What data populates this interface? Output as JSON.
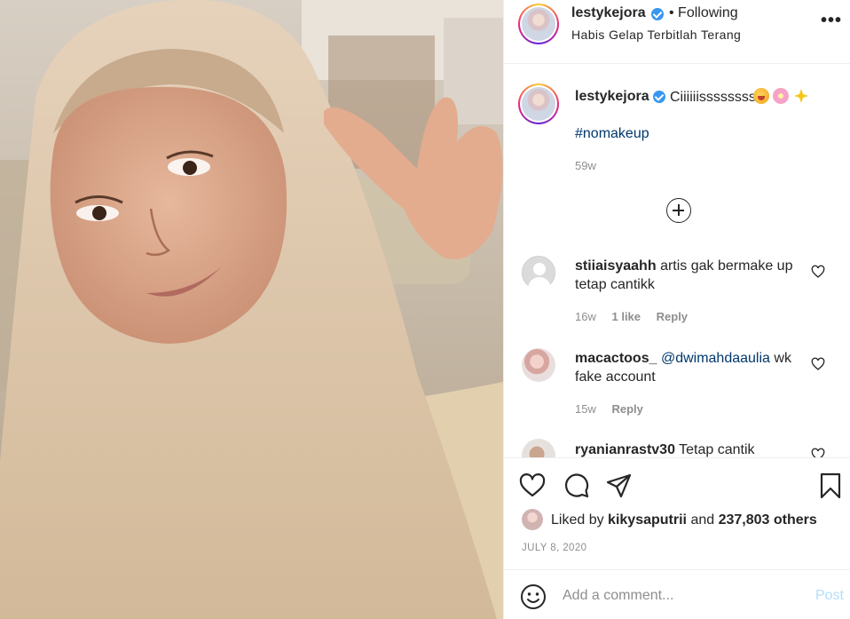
{
  "post": {
    "author": "lestykejora",
    "follow_state": "• Following",
    "location": "Habis Gelap Terbitlah Terang",
    "more_label": "•••",
    "caption_text": "Ciiiiiissssssss",
    "hashtag": "#nomakeup",
    "caption_time": "59w"
  },
  "comments": [
    {
      "username": "stiiaisyaahh",
      "text": "artis gak bermake up tetap cantikk",
      "time": "16w",
      "likes": "1 like",
      "reply": "Reply"
    },
    {
      "username": "macactoos_",
      "mention": "@dwimahdaaulia",
      "text": "wk fake account",
      "time": "15w",
      "reply": "Reply"
    },
    {
      "username": "ryanianrastv30",
      "text": "Tetap cantik"
    }
  ],
  "likes": {
    "prefix": "Liked by",
    "user": "kikysaputrii",
    "joiner": "and",
    "others": "237,803 others"
  },
  "date": "JULY 8, 2020",
  "add_comment": {
    "placeholder": "Add a comment...",
    "post_label": "Post"
  },
  "icons": [
    "verified-badge-icon",
    "heart-icon",
    "comment-icon",
    "share-icon",
    "bookmark-icon",
    "emoji-icon",
    "plus-circle-icon"
  ],
  "colors": {
    "link": "#00376b",
    "muted": "#8e8e8e",
    "verified": "#3897f0",
    "post_disabled": "#b2dffc"
  }
}
